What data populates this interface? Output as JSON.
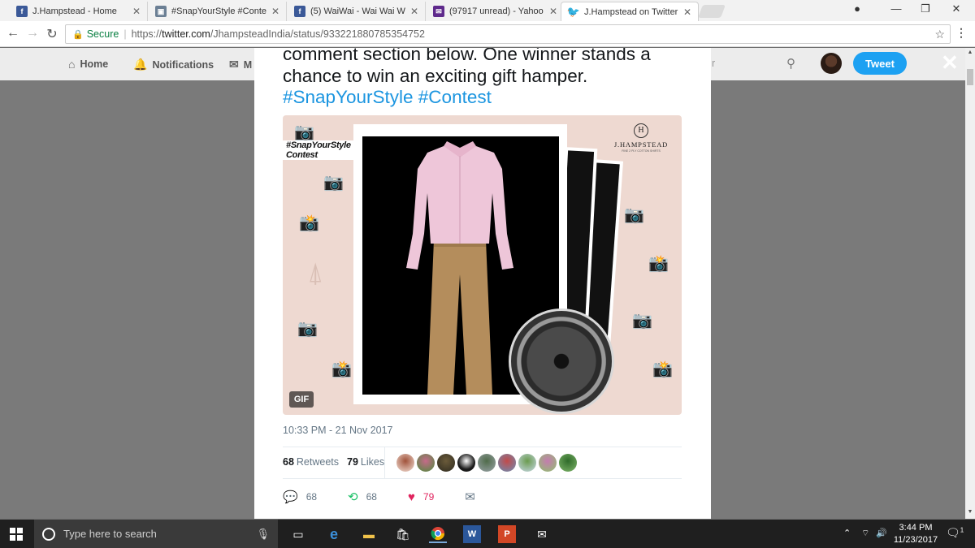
{
  "browser": {
    "tabs": [
      {
        "title": "J.Hampstead - Home",
        "favicon": "facebook-icon"
      },
      {
        "title": "#SnapYourStyle #Contest",
        "favicon": "page-icon"
      },
      {
        "title": "(5) WaiWai - Wai Wai Wa",
        "favicon": "facebook-icon"
      },
      {
        "title": "(97917 unread) - Yahoo",
        "favicon": "mail-icon"
      },
      {
        "title": "J.Hampstead on Twitter:",
        "favicon": "twitter-icon",
        "active": true
      }
    ],
    "secure_label": "Secure",
    "url_prefix": "https://",
    "url_host": "twitter.com",
    "url_path": "/JhampsteadIndia/status/933221880785354752"
  },
  "twitter_nav": {
    "home": "Home",
    "notifications": "Notifications",
    "messages_partial": "M",
    "search_partial": "r",
    "tweet_button": "Tweet"
  },
  "tweet": {
    "text_line1": "comment section below. One winner stands a",
    "text_line2": "chance to win an exciting gift hamper.",
    "hashtags": "#SnapYourStyle #Contest",
    "media": {
      "contest_tag": "#SnapYourStyle Contest",
      "brand_mark": "H",
      "brand_name": "J.HAMPSTEAD",
      "brand_sub": "FINE 2 PLY COTTON SHIRTS",
      "gif_label": "GIF"
    },
    "timestamp": "10:33 PM - 21 Nov 2017",
    "retweets_count": "68",
    "retweets_label": "Retweets",
    "likes_count": "79",
    "likes_label": "Likes",
    "actions": {
      "reply_count": "68",
      "retweet_count": "68",
      "like_count": "79"
    }
  },
  "taskbar": {
    "search_placeholder": "Type here to search",
    "time": "3:44 PM",
    "date": "11/23/2017",
    "notification_count": "1"
  },
  "colors": {
    "twitter_blue": "#1da1f2",
    "hashtag_blue": "#1b95e0",
    "like_red": "#e0245e",
    "chrome_secure_green": "#0b8043"
  }
}
